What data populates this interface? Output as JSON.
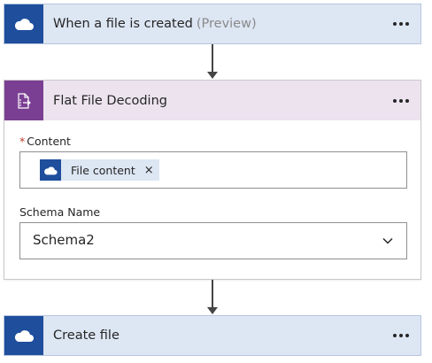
{
  "trigger": {
    "title": "When a file is created",
    "tag": "(Preview)",
    "icon": "onedrive-cloud-icon"
  },
  "action": {
    "title": "Flat File Decoding",
    "icon": "flat-file-decode-icon",
    "content_field": {
      "required_mark": "*",
      "label": "Content",
      "token_label": "File content",
      "token_remove": "×"
    },
    "schema_field": {
      "label": "Schema Name",
      "value": "Schema2"
    }
  },
  "final_step": {
    "title": "Create file",
    "icon": "onedrive-cloud-icon"
  },
  "colors": {
    "onedrive_blue": "#1e4e9c",
    "connector_bg": "#dde6f3",
    "flatfile_purple": "#7a3f93",
    "flatfile_header_bg": "#ece3ef"
  }
}
